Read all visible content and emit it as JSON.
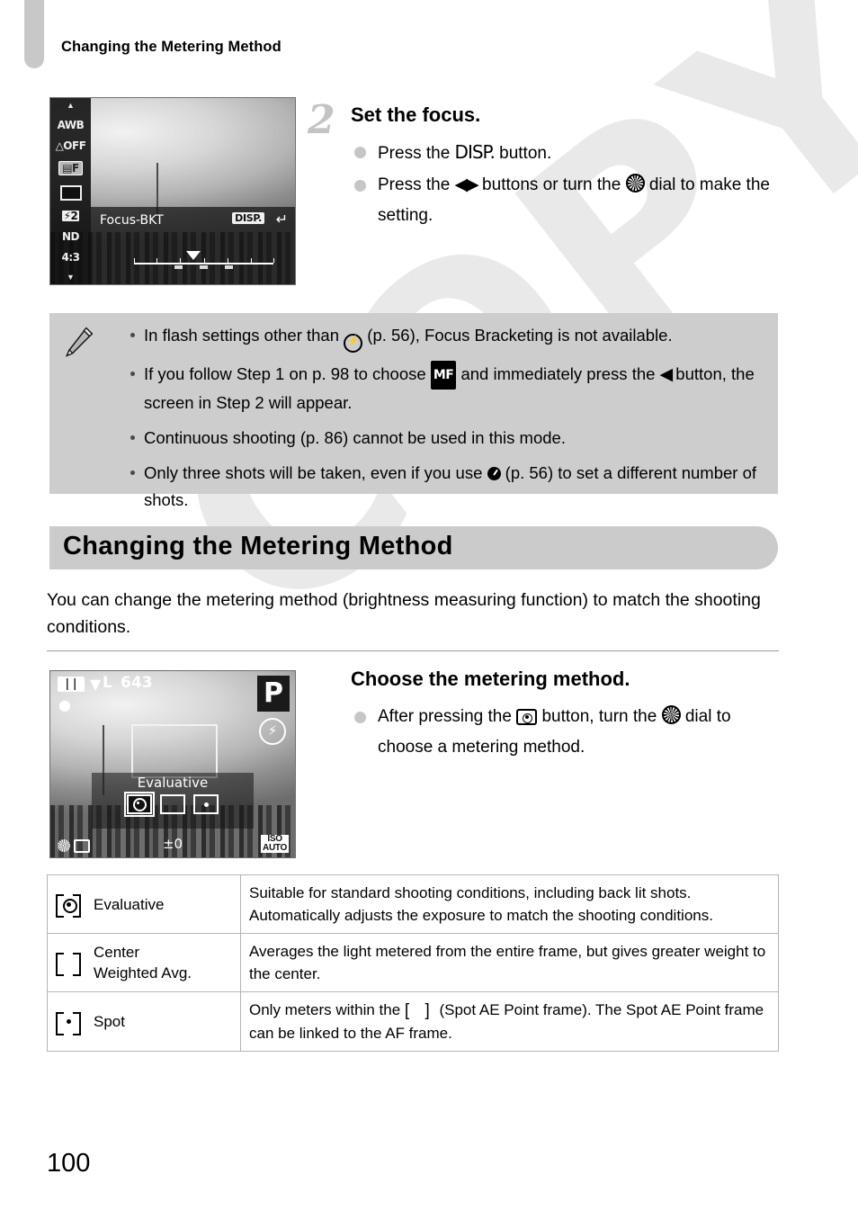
{
  "page": {
    "running_head": "Changing the Metering Method",
    "page_number": "100",
    "watermark": "COPY"
  },
  "colors": {
    "tab_gray": "#c8c8c8",
    "note_gray": "#cdcdcd",
    "heading_gray": "#cbcbcb",
    "step_number_gray": "#c4c4c4",
    "rule_gray": "#9a9a9a",
    "table_border": "#b4b4b4"
  },
  "step2": {
    "number": "2",
    "title": "Set the focus.",
    "bullets": [
      {
        "pre": "Press the ",
        "glyph": "disp-button-icon",
        "glyph_text": "DISP.",
        "post": " button."
      },
      {
        "pre": "Press the ",
        "glyph": "left-right-buttons-icon",
        "glyph_text": "◀▶",
        "mid": " buttons or turn the ",
        "glyph2": "control-dial-icon",
        "post": " dial to make the setting."
      }
    ]
  },
  "lcd1": {
    "left_icons": [
      "AWB",
      "OFF",
      "FILTER",
      "FRAME",
      "FLASH-EXP",
      "NR",
      "4:3"
    ],
    "selected_icon_index": 2,
    "label": "Focus-BKT",
    "disp_chip": "DISP.",
    "back_glyph": "↵"
  },
  "note": {
    "icon": "pencil-icon",
    "items": [
      {
        "parts": [
          "In flash settings other than ",
          "flash-off-icon",
          " (p. 56), Focus Bracketing is not available."
        ]
      },
      {
        "parts": [
          "If you follow Step 1 on p. 98 to choose ",
          "manual-focus-icon",
          " and immediately press the ",
          "left-button-icon",
          " button, the screen in Step 2 will appear."
        ]
      },
      {
        "parts": [
          "Continuous shooting (p. 86) cannot be used in this mode."
        ]
      },
      {
        "parts": [
          "Only three shots will be taken, even if you use ",
          "self-timer-icon",
          " (p. 56) to set a different number of shots."
        ]
      }
    ]
  },
  "section": {
    "title": "Changing the Metering Method",
    "intro": "You can change the metering method (brightness measuring function) to match the shooting conditions."
  },
  "step_choose": {
    "title": "Choose the metering method.",
    "bullet": {
      "pre": "After pressing the ",
      "glyph": "metering-button-icon",
      "mid": " button, turn the ",
      "glyph2": "control-dial-icon",
      "post": " dial to choose a metering method."
    }
  },
  "lcd2": {
    "quality": "L",
    "shots_remaining": "643",
    "mode": "P",
    "metering_label": "Evaluative",
    "exposure_comp": "±0",
    "iso_label_top": "ISO",
    "iso_label_bottom": "AUTO",
    "metering_options": [
      "evaluative-icon",
      "center-weighted-icon",
      "spot-icon"
    ],
    "selected_option_index": 0
  },
  "table": {
    "rows": [
      {
        "icon": "evaluative-icon",
        "name": "Evaluative",
        "description": "Suitable for standard shooting conditions, including back lit shots. Automatically adjusts the exposure to match the shooting conditions."
      },
      {
        "icon": "center-weighted-icon",
        "name": "Center Weighted Avg.",
        "name_line1": "Center",
        "name_line2": "Weighted Avg.",
        "description": "Averages the light metered from the entire frame, but gives greater weight to the center."
      },
      {
        "icon": "spot-icon",
        "name": "Spot",
        "description_pre": "Only meters within the ",
        "description_glyph": "spot-ae-frame-icon",
        "description_post": " (Spot AE Point frame). The Spot AE Point frame can be linked to the AF frame."
      }
    ]
  }
}
